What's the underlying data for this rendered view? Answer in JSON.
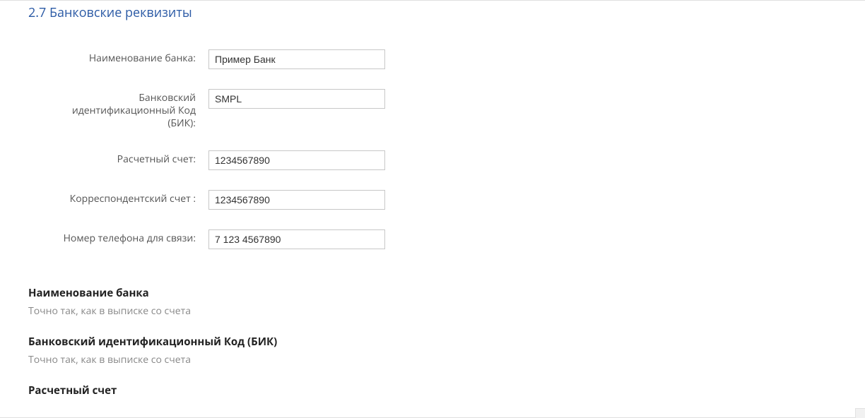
{
  "section": {
    "title": "2.7 Банковские реквизиты"
  },
  "fields": {
    "bank_name": {
      "label": "Наименование банка:",
      "value": "Пример Банк"
    },
    "bik": {
      "label": "Банковский идентификационный Код (БИК):",
      "value": "SMPL"
    },
    "acct": {
      "label": "Расчетный счет:",
      "value": "1234567890"
    },
    "corr_acct": {
      "label": "Корреспондентский счет :",
      "value": "1234567890"
    },
    "phone": {
      "label": "Номер телефона для связи:",
      "value": "7 123 4567890"
    }
  },
  "hints": {
    "bank_name": {
      "title": "Наименование банка",
      "text": "Точно так, как в выписке со счета"
    },
    "bik": {
      "title": "Банковский идентификационный Код (БИК)",
      "text": "Точно так, как в выписке со счета"
    },
    "acct": {
      "title": "Расчетный счет",
      "text": ""
    }
  }
}
